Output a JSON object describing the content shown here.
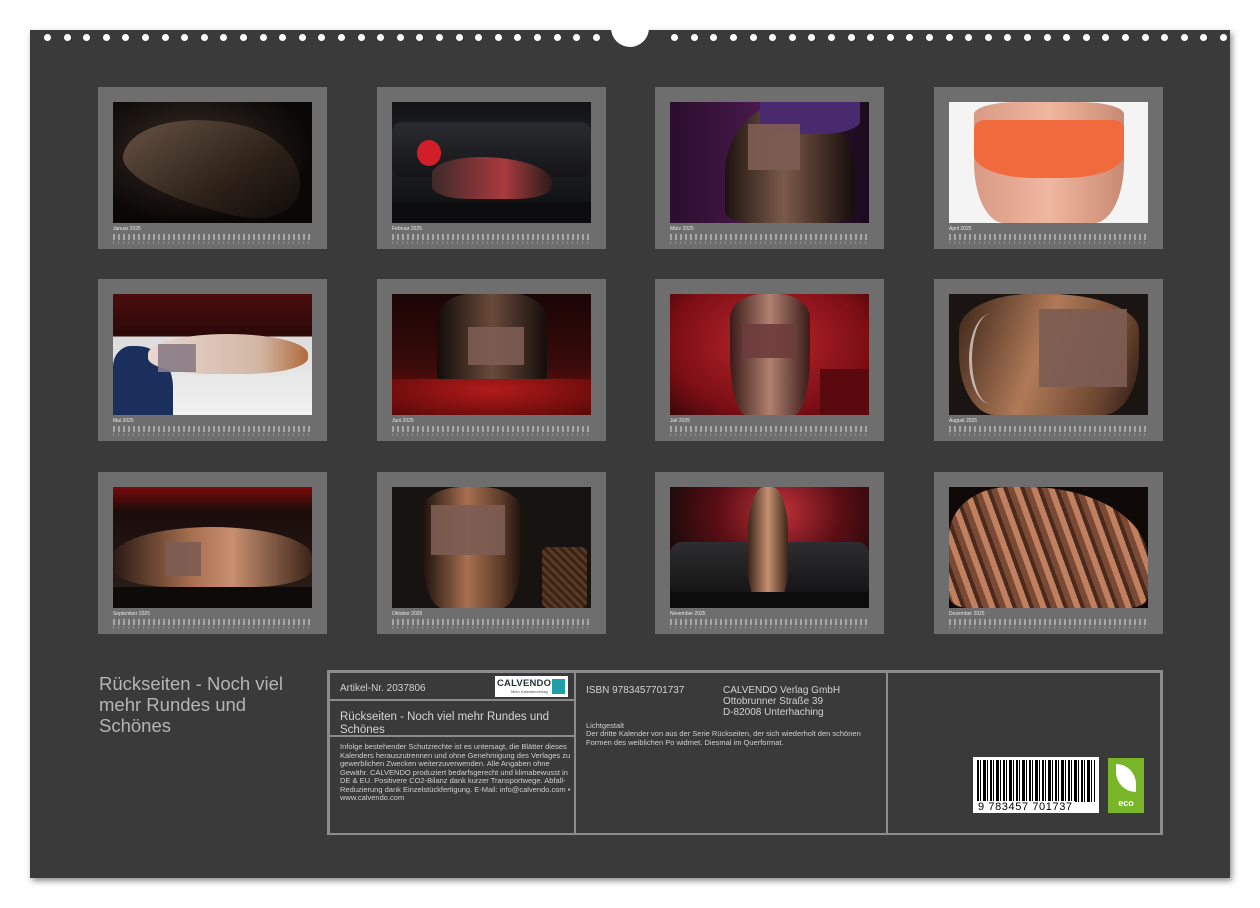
{
  "cover_title": "Rückseiten - Noch viel mehr Rundes und Schönes",
  "months": [
    {
      "label": "Januar 2025",
      "scene": "dark-curves"
    },
    {
      "label": "Februar 2025",
      "scene": "red-sofa"
    },
    {
      "label": "März 2025",
      "scene": "purple-lace"
    },
    {
      "label": "April 2025",
      "scene": "white-shorts"
    },
    {
      "label": "Mai 2025",
      "scene": "bed-white"
    },
    {
      "label": "Juni 2025",
      "scene": "red-sheets"
    },
    {
      "label": "Juli 2025",
      "scene": "red-wall"
    },
    {
      "label": "August 2025",
      "scene": "milk-splash"
    },
    {
      "label": "September 2025",
      "scene": "leather-sofa"
    },
    {
      "label": "Oktober 2025",
      "scene": "dark-chair"
    },
    {
      "label": "November 2025",
      "scene": "ornament-wall"
    },
    {
      "label": "Dezember 2025",
      "scene": "stripe-light"
    }
  ],
  "info": {
    "article": "Artikel-Nr. 2037806",
    "logo_text": "CALVENDO",
    "logo_subtext": "Mein Kalenderverlag",
    "title": "Rückseiten - Noch viel mehr Rundes und Schönes",
    "legal": "Infolge bestehender Schutzrechte ist es untersagt, die Blätter dieses Kalenders herauszutrennen und ohne Genehmigung des Verlages zu gewerblichen Zwecken weiterzuverwenden. Alle Angaben ohne Gewähr. CALVENDO produziert bedarfsgerecht und klimabewusst in DE & EU. Positivere CO2-Bilanz dank kurzer Transportwege. Abfall-Reduzierung dank Einzelstückfertigung. E-Mail: info@calvendo.com • www.calvendo.com",
    "isbn": "ISBN 9783457701737",
    "publisher": [
      "CALVENDO Verlag GmbH",
      "Ottobrunner Straße 39",
      "D-82008 Unterhaching"
    ],
    "description_heading": "Lichtgestalt",
    "description": "Der dritte Kalender von aus der Serie Rückseiten, der sich wiederholt den schönen Formen des weiblichen Po widmet. Diesmal im Querformat.",
    "barcode_digits": "9 783457 701737",
    "eco_label": "eco"
  },
  "colors": {
    "sheet": "#3a3a3a",
    "tile": "#6e6e6e",
    "border": "#8c8c8c",
    "eco": "#79b529"
  }
}
